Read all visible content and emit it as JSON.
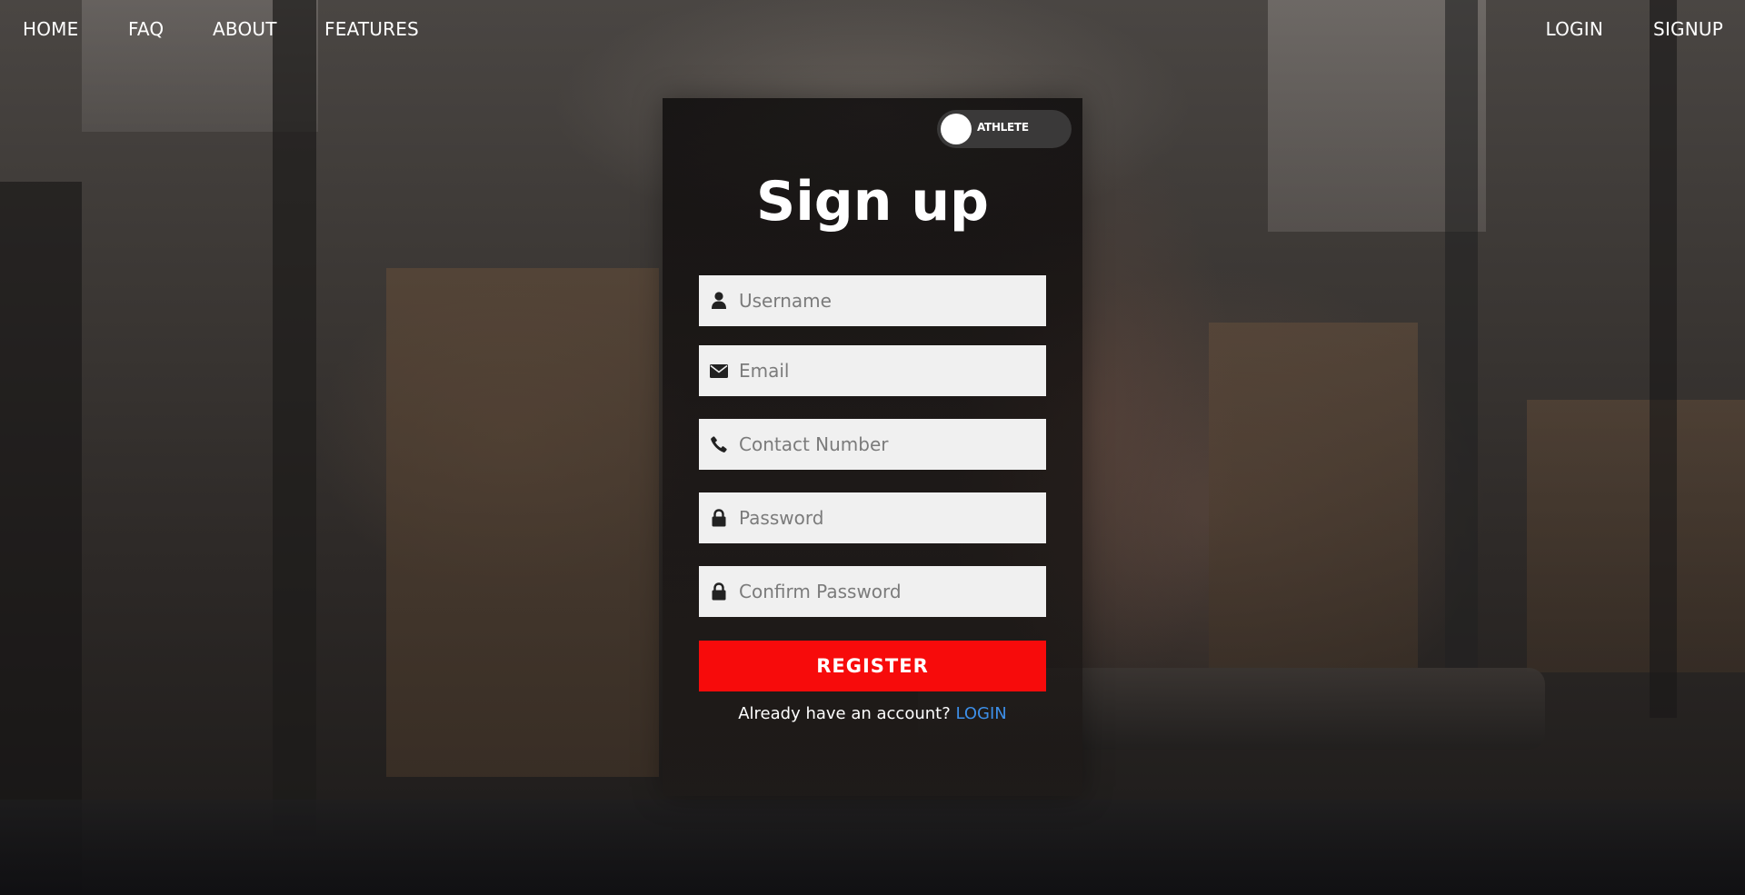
{
  "nav": {
    "left": [
      {
        "label": "HOME"
      },
      {
        "label": "FAQ"
      },
      {
        "label": "ABOUT"
      },
      {
        "label": "FEATURES"
      }
    ],
    "right": [
      {
        "label": "LOGIN"
      },
      {
        "label": "SIGNUP"
      }
    ]
  },
  "form": {
    "toggle_label": "ATHLETE",
    "title": "Sign up",
    "fields": [
      {
        "placeholder": "Username",
        "value": "",
        "icon": "user-icon"
      },
      {
        "placeholder": "Email",
        "value": "",
        "icon": "envelope-icon"
      },
      {
        "placeholder": "Contact Number",
        "value": "",
        "icon": "phone-icon"
      },
      {
        "placeholder": "Password",
        "value": "",
        "icon": "lock-icon"
      },
      {
        "placeholder": "Confirm Password",
        "value": "",
        "icon": "lock-icon"
      }
    ],
    "register_label": "REGISTER",
    "account_prompt": "Already have an account?",
    "login_link": "LOGIN"
  },
  "colors": {
    "accent_red": "#f70b0b",
    "link_blue": "#3d8fe8",
    "field_bg": "#f0f0f0",
    "toggle_bg": "#3a3939"
  }
}
